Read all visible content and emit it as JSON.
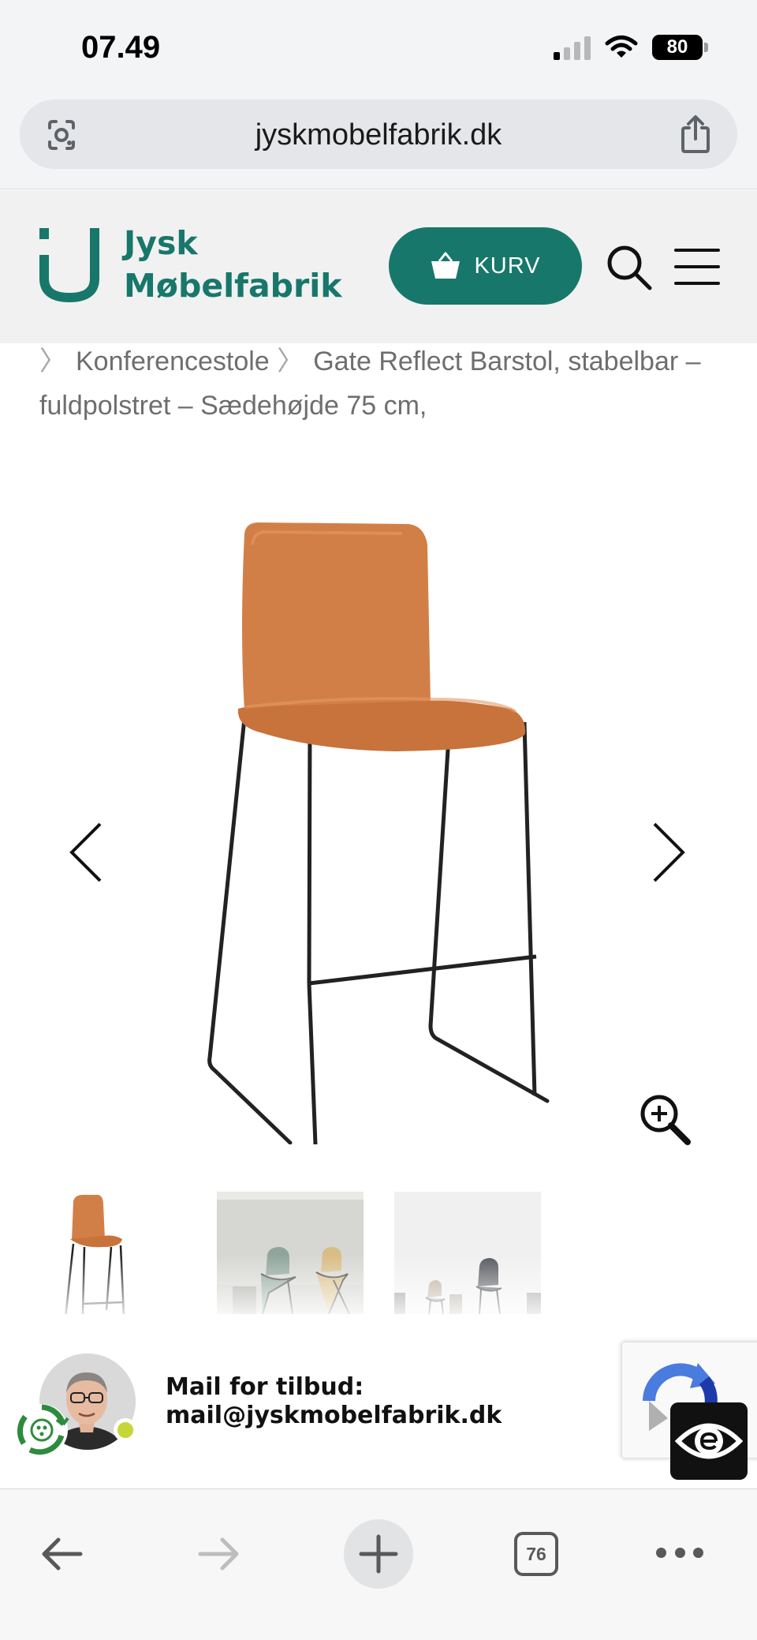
{
  "status_bar": {
    "time": "07.49",
    "battery": "80"
  },
  "browser": {
    "url": "jyskmobelfabrik.dk"
  },
  "header": {
    "logo_line1": "Jysk",
    "logo_line2": "Møbelfabrik",
    "cart_label": "KURV",
    "brand_color": "#17776a"
  },
  "breadcrumb": {
    "items": [
      "Konferencestole",
      "Gate Reflect Barstol, stabelbar – fuldpolstret – Sædehøjde 75 cm,"
    ]
  },
  "product": {
    "image_icon": "orange-upholstered-bar-stool",
    "seat_color": "#d27f47",
    "frame_color": "#222222"
  },
  "contact": {
    "title": "Mail for tilbud:",
    "email": "mail@jyskmobelfabrik.dk"
  },
  "toolbar": {
    "tab_count": "76"
  }
}
